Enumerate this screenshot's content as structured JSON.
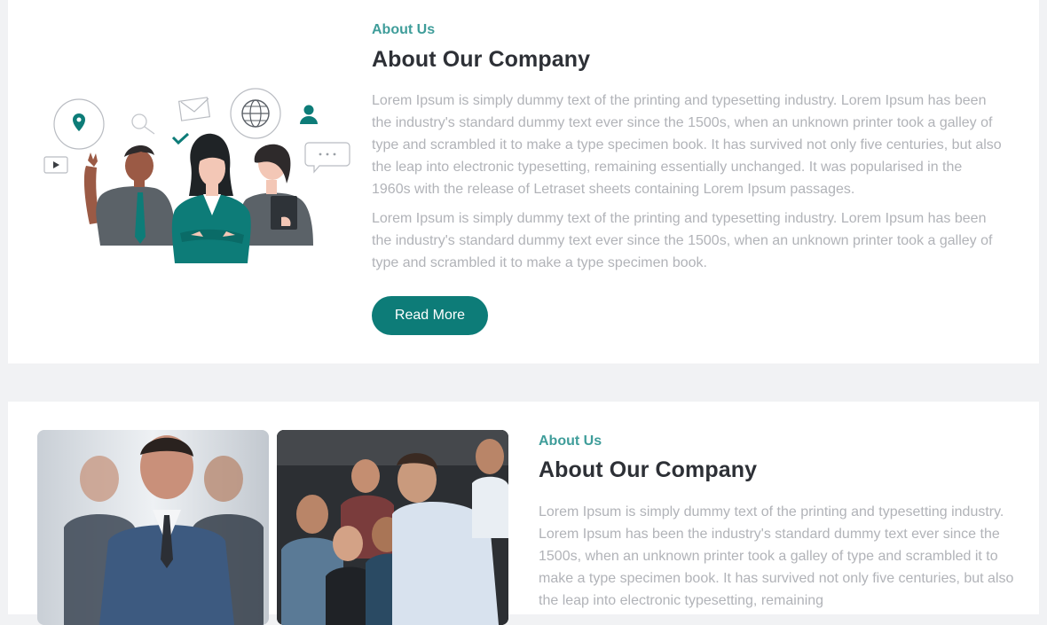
{
  "sections": [
    {
      "eyebrow": "About Us",
      "heading": "About Our Company",
      "paragraph_1": "Lorem Ipsum is simply dummy text of the printing and typesetting industry. Lorem Ipsum has been the industry's standard dummy text ever since the 1500s, when an unknown printer took a galley of type and scrambled it to make a type specimen book. It has survived not only five centuries, but also the leap into electronic typesetting, remaining essentially unchanged. It was popularised in the 1960s with the release of Letraset sheets containing Lorem Ipsum passages.",
      "paragraph_2": "Lorem Ipsum is simply dummy text of the printing and typesetting industry. Lorem Ipsum has been the industry's standard dummy text ever since the 1500s, when an unknown printer took a galley of type and scrambled it to make a type specimen book.",
      "button_label": "Read More"
    },
    {
      "eyebrow": "About Us",
      "heading": "About Our Company",
      "paragraph_1": "Lorem Ipsum is simply dummy text of the printing and typesetting industry. Lorem Ipsum has been the industry's standard dummy text ever since the 1500s, when an unknown printer took a galley of type and scrambled it to make a type specimen book. It has survived not only five centuries, but also the leap into electronic typesetting, remaining"
    }
  ],
  "colors": {
    "accent": "#3f9d9a",
    "button": "#0d7c78",
    "heading": "#2d3036",
    "body_text": "#b1b3b8",
    "page_bg": "#f1f2f4",
    "card_bg": "#ffffff"
  },
  "icons": [
    "location-pin-icon",
    "search-icon",
    "mail-icon",
    "globe-icon",
    "user-icon",
    "check-icon",
    "play-icon",
    "chat-bubble-icon"
  ]
}
